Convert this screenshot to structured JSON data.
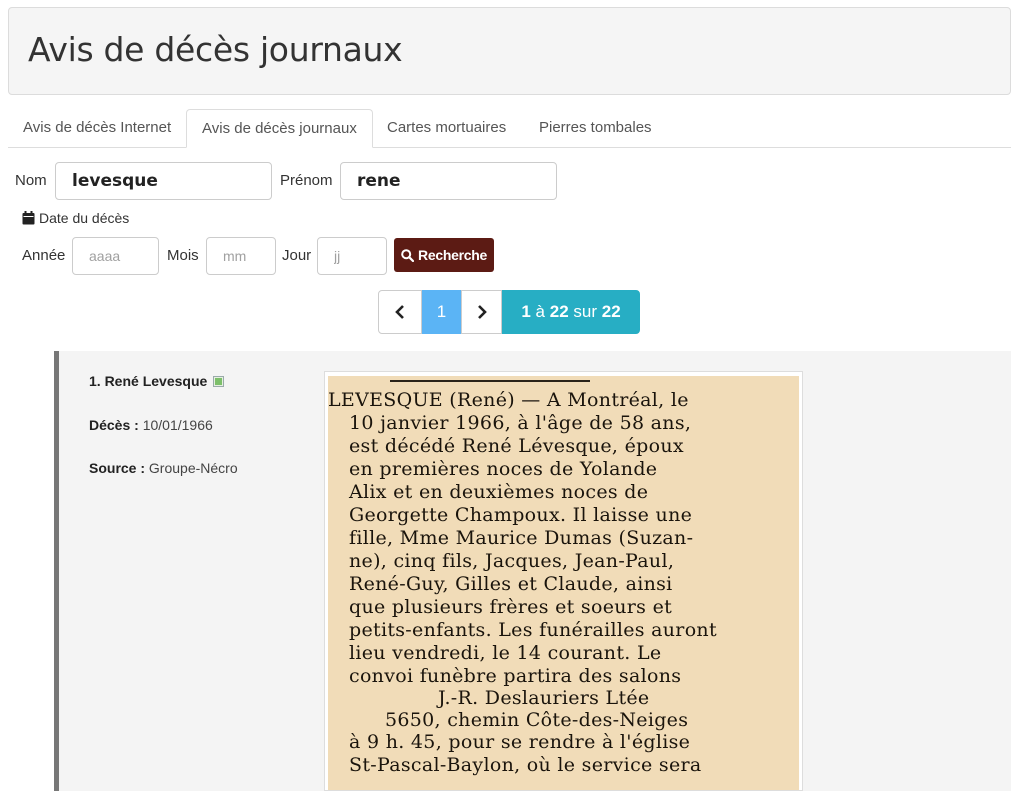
{
  "page_title": "Avis de décès journaux",
  "tabs": [
    {
      "label": "Avis de décès Internet",
      "active": false
    },
    {
      "label": "Avis de décès journaux",
      "active": true
    },
    {
      "label": "Cartes mortuaires",
      "active": false
    },
    {
      "label": "Pierres tombales",
      "active": false
    }
  ],
  "search": {
    "nom_label": "Nom",
    "nom_value": "levesque",
    "prenom_label": "Prénom",
    "prenom_value": "rene",
    "date_label": "Date du décès",
    "annee_label": "Année",
    "annee_placeholder": "aaaa",
    "mois_label": "Mois",
    "mois_placeholder": "mm",
    "jour_label": "Jour",
    "jour_placeholder": "jj",
    "button_label": "Recherche"
  },
  "pagination": {
    "current_page": "1",
    "range_start": "1",
    "range_word": "à",
    "range_end": "22",
    "of_word": "sur",
    "total": "22"
  },
  "result": {
    "title": "1. René Levesque",
    "death_label": "Décès :",
    "death_date": "10/01/1966",
    "source_label": "Source :",
    "source_value": "Groupe-Nécro",
    "clipping_lines": [
      "LEVESQUE (René) — A Montréal, le",
      "10 janvier 1966, à l'âge de 58 ans,",
      "est décédé René Lévesque, époux",
      "en premières noces de Yolande",
      "Alix et en deuxièmes noces de",
      "Georgette Champoux. Il laisse une",
      "fille, Mme Maurice Dumas (Suzan-",
      "ne), cinq fils, Jacques, Jean-Paul,",
      "René-Guy, Gilles et Claude, ainsi",
      "que plusieurs frères et soeurs et",
      "petits-enfants. Les funérailles auront",
      "lieu vendredi, le 14 courant. Le",
      "convoi funèbre partira des salons",
      "J.-R. Deslauriers Ltée",
      "5650, chemin Côte-des-Neiges",
      "à 9 h. 45, pour se rendre à l'église",
      "St-Pascal-Baylon, où le service sera"
    ]
  }
}
